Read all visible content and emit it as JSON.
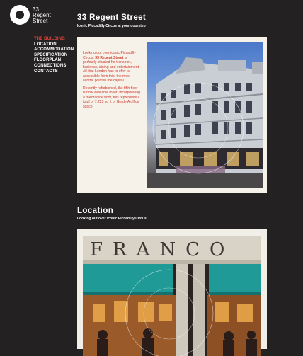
{
  "logo": {
    "line1": "33",
    "line2": "Regent",
    "line3": "Street"
  },
  "nav": {
    "items": [
      {
        "label": "THE BUILDING",
        "active": true
      },
      {
        "label": "LOCATION",
        "active": false
      },
      {
        "label": "ACCOMMODATION",
        "active": false
      },
      {
        "label": "SPECIFICATION",
        "active": false
      },
      {
        "label": "FLOORPLAN",
        "active": false
      },
      {
        "label": "CONNECTIONS",
        "active": false
      },
      {
        "label": "CONTACTS",
        "active": false
      }
    ]
  },
  "building": {
    "title": "33 Regent Street",
    "subtitle": "Iconic Piccadilly Circus at your doorstep",
    "para1_before": "Looking out over iconic Piccadilly Circus, ",
    "para1_bold": "33 Regent Street",
    "para1_after": " is perfectly situated for transport, business, dining and entertainment. All that London has to offer is accessible from this, the most central point in the capital.",
    "para2": "Recently refurbished, the fifth floor is now available to let. Incorporating a mezzanine floor, this represents a total of 7,223 sq ft of Grade A office space."
  },
  "location": {
    "title": "Location",
    "subtitle": "Looking out over iconic Piccadilly Circus",
    "sign_text": "FRANCO"
  },
  "colors": {
    "background": "#242122",
    "accent": "#e0443a",
    "intro_text": "#cf3b2e",
    "panel": "#f6f2ea",
    "awning": "#1f9a97"
  }
}
